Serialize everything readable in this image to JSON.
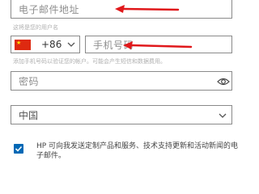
{
  "email": {
    "placeholder": "电子邮件地址",
    "hint": "这将是您的用户名"
  },
  "phone": {
    "country_code": "+86",
    "flag": "china-flag-icon",
    "placeholder": "手机号码",
    "hint": "添加手机号码以验证您的帐户。可能会产生短信和数据费用。"
  },
  "password": {
    "placeholder": "密码",
    "icon": "eye-icon"
  },
  "country": {
    "selected": "中国"
  },
  "consent": {
    "checked": true,
    "text": "HP 可向我发送定制产品和服务、技术支持更新和活动新闻的电子邮件。"
  },
  "colors": {
    "accent": "#0068b5",
    "annotation": "#e0181b"
  }
}
